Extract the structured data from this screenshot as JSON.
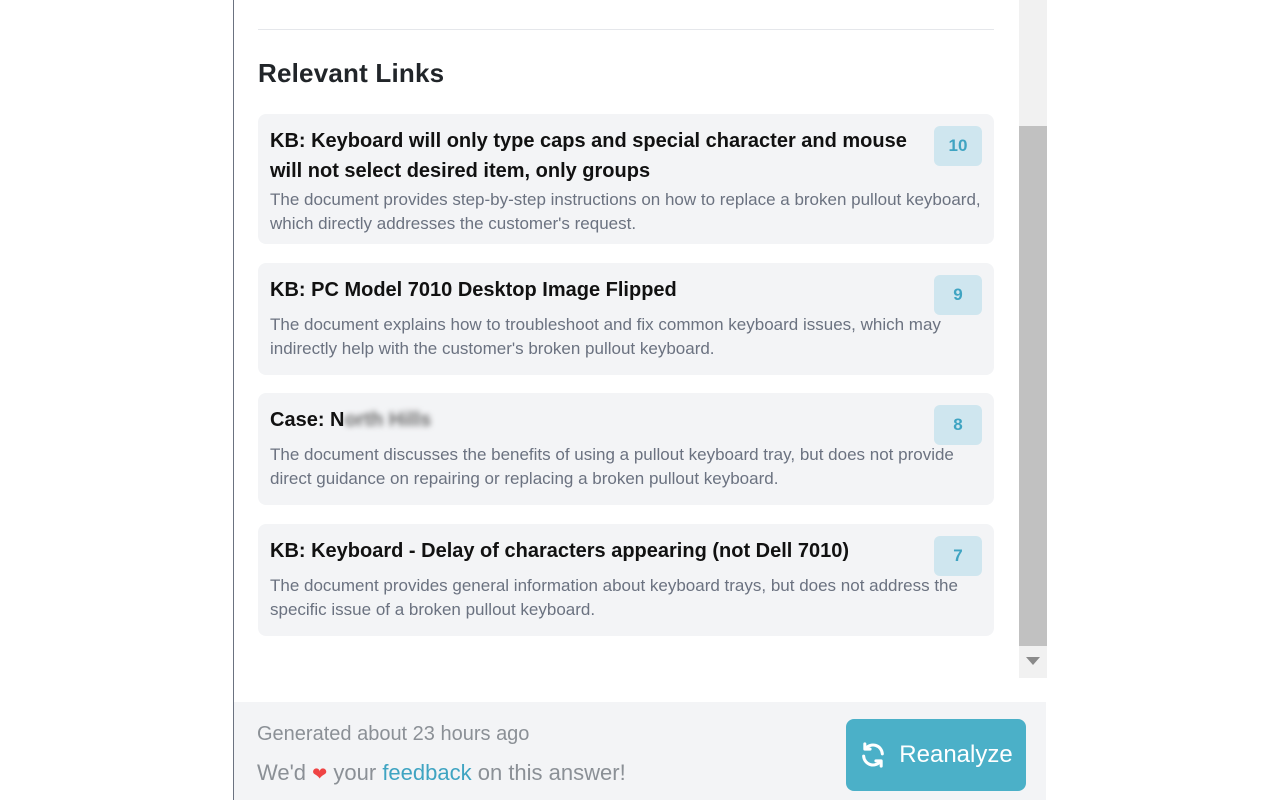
{
  "section": {
    "title": "Relevant Links"
  },
  "links": [
    {
      "title": "KB: Keyboard will only type caps and special character and mouse will not select desired item, only groups",
      "description": "The document provides step-by-step instructions on how to replace a broken pullout keyboard, which directly addresses the customer's request.",
      "score": "10"
    },
    {
      "title": "KB: PC Model 7010 Desktop Image Flipped",
      "description": "The document explains how to troubleshoot and fix common keyboard issues, which may indirectly help with the customer's broken pullout keyboard.",
      "score": "9"
    },
    {
      "title_prefix": "Case: N",
      "title_redacted": "orth Hills",
      "description": "The document discusses the benefits of using a pullout keyboard tray, but does not provide direct guidance on repairing or replacing a broken pullout keyboard.",
      "score": "8"
    },
    {
      "title": "KB: Keyboard - Delay of characters appearing (not Dell 7010)",
      "description": "The document provides general information about keyboard trays, but does not address the specific issue of a broken pullout keyboard.",
      "score": "7"
    }
  ],
  "footer": {
    "generated": "Generated about 23 hours ago",
    "feedback_prefix": "We'd",
    "feedback_middle": "your",
    "feedback_link": "feedback",
    "feedback_suffix": "on this answer!",
    "reanalyze_label": "Reanalyze"
  },
  "icons": {
    "heart": "heart-icon",
    "refresh": "refresh-icon",
    "scroll_down": "scroll-down-arrow-icon"
  },
  "colors": {
    "accent": "#4bb0c8",
    "badge_bg": "#cfe6ef",
    "badge_text": "#3fa4c2",
    "card_bg": "#f3f4f6",
    "heart": "#ef4444"
  }
}
